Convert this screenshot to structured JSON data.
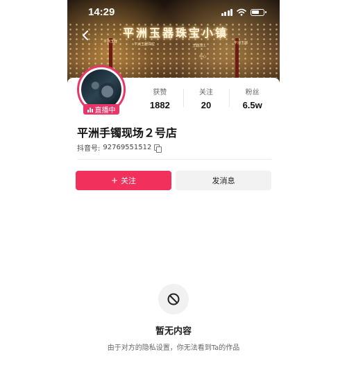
{
  "status_bar": {
    "time": "14:29"
  },
  "banner": {
    "sign_text": "平洲玉器珠宝小镇",
    "sign_small_texts": [
      "平洲玉器",
      "平洲玉器珠宝",
      "玉器加工",
      "平洲玉器",
      "中心"
    ]
  },
  "profile": {
    "live_badge": "直播中",
    "stats": [
      {
        "label": "获赞",
        "value": "1882"
      },
      {
        "label": "关注",
        "value": "20"
      },
      {
        "label": "粉丝",
        "value": "6.5w"
      }
    ],
    "name": "平洲手镯现场２号店",
    "account_label": "抖音号:",
    "account_id": "92769551512"
  },
  "actions": {
    "follow_label": "关注",
    "message_label": "发消息"
  },
  "empty_state": {
    "title": "暂无内容",
    "description": "由于对方的隐私设置，你无法看到Ta的作品"
  },
  "colors": {
    "accent": "#f2305c",
    "live_badge": "#e8356a"
  },
  "icons": [
    "back-icon",
    "signal-icon",
    "wifi-icon",
    "battery-icon",
    "live-icon",
    "copy-icon",
    "plus-icon",
    "no-entry-icon"
  ]
}
